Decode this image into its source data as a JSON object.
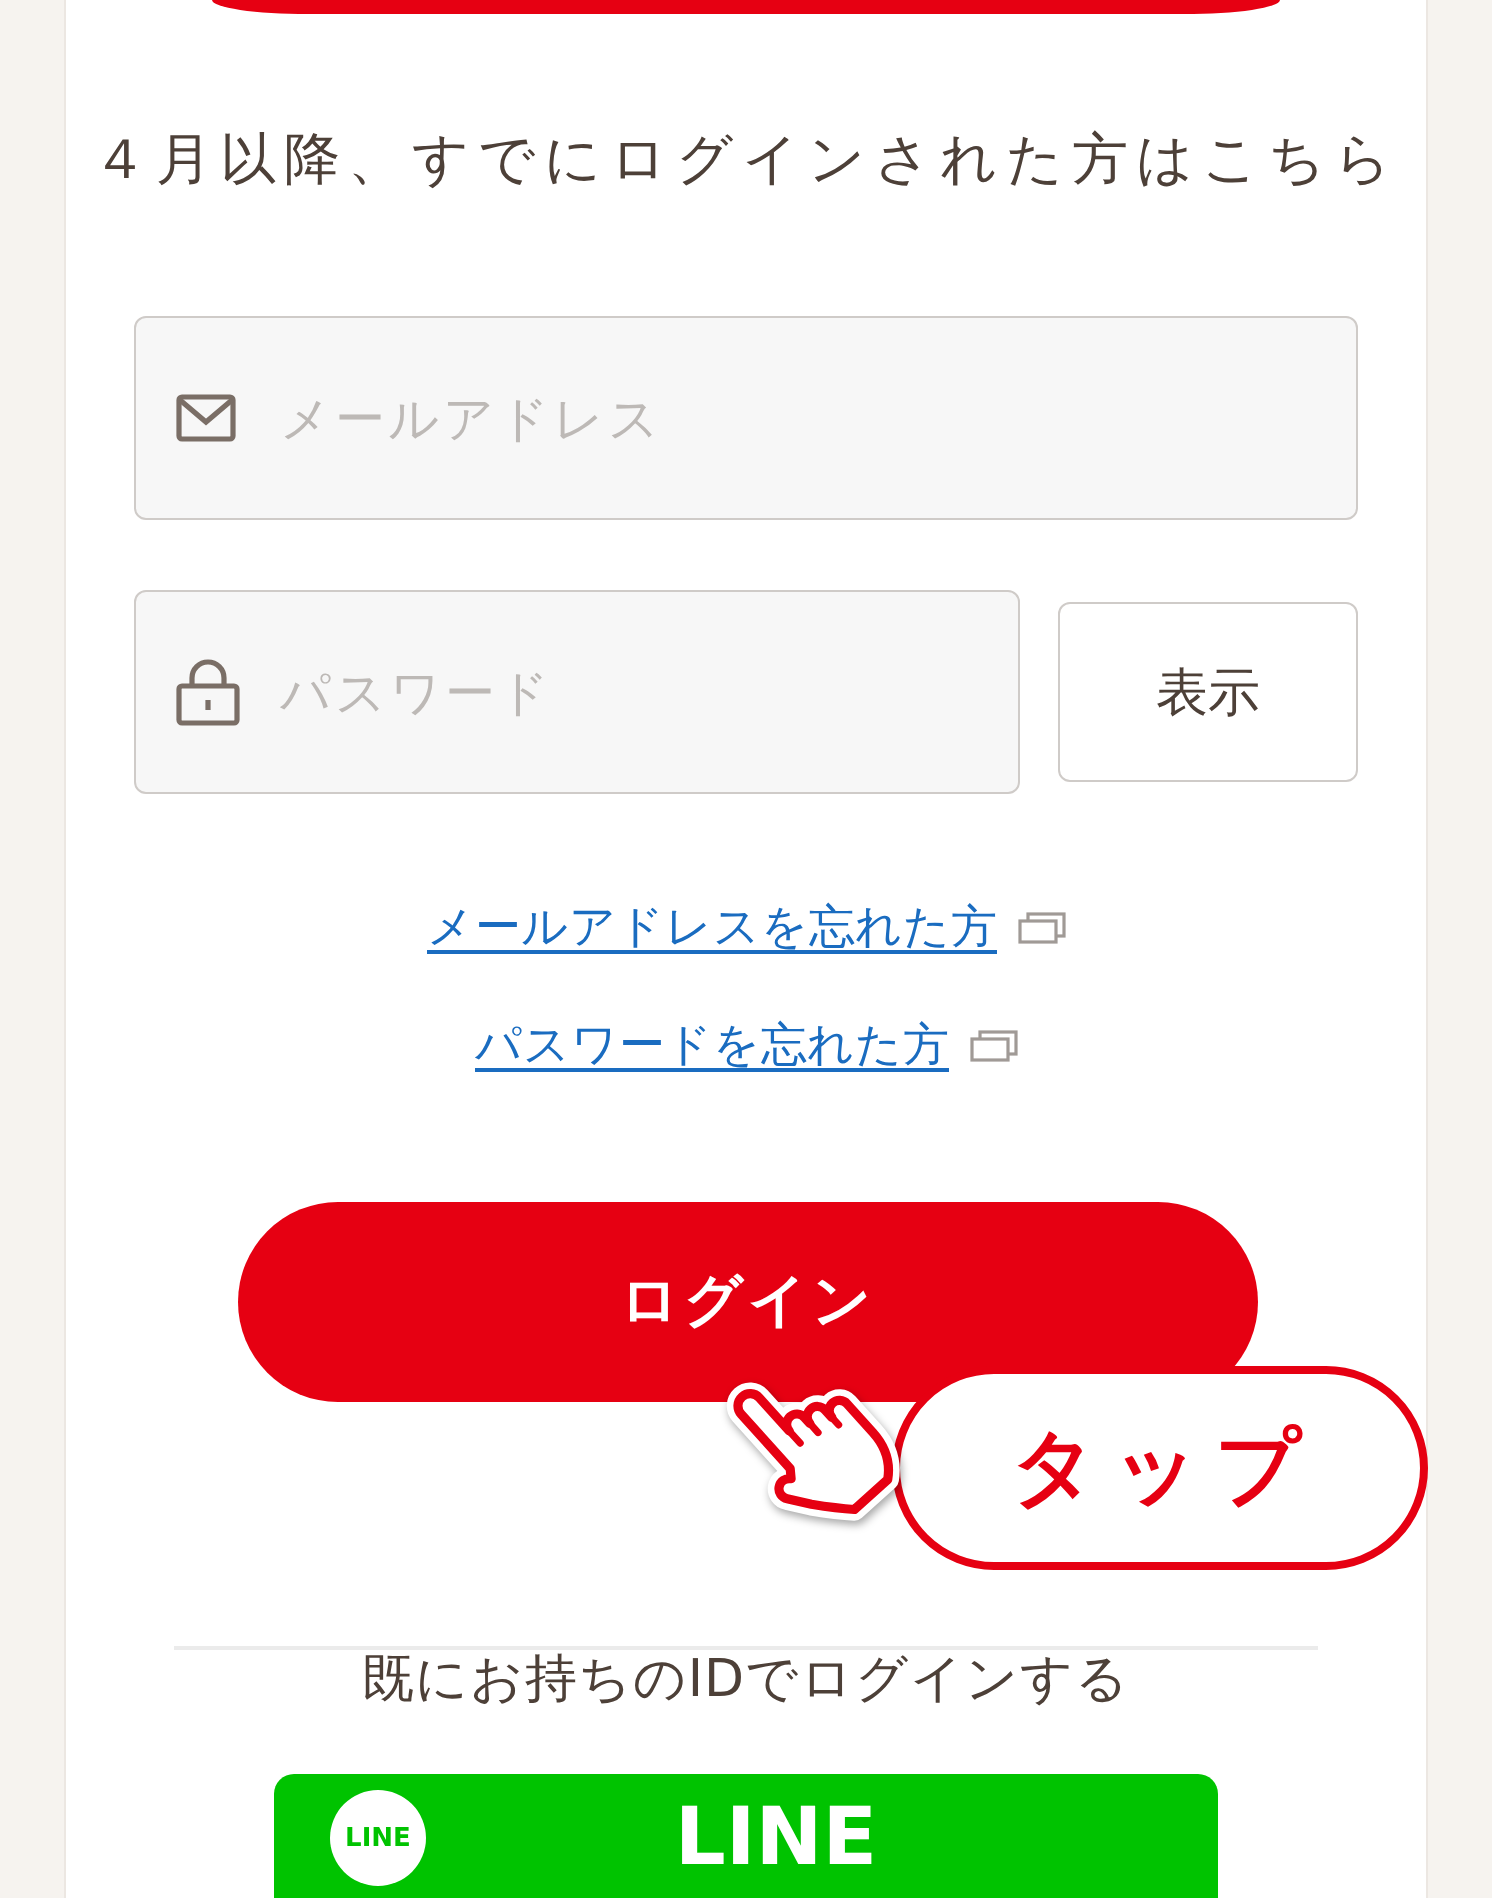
{
  "heading": "４月以降、すでにログインされた方はこちら",
  "fields": [
    {
      "kind": "email",
      "placeholder": "メールアドレス"
    },
    {
      "kind": "password",
      "placeholder": "パスワード",
      "toggle_label": "表示"
    }
  ],
  "help_links": [
    {
      "label": "メールアドレスを忘れた方",
      "opens_new_window": true
    },
    {
      "label": "パスワードを忘れた方",
      "opens_new_window": true
    }
  ],
  "login_button": {
    "label": "ログイン"
  },
  "tap_callout": {
    "label": "タップ"
  },
  "social_login": {
    "heading": "既にお持ちのIDでログインする",
    "providers": [
      {
        "kind": "line",
        "logo": "LINE",
        "label": "LINE"
      }
    ]
  }
}
